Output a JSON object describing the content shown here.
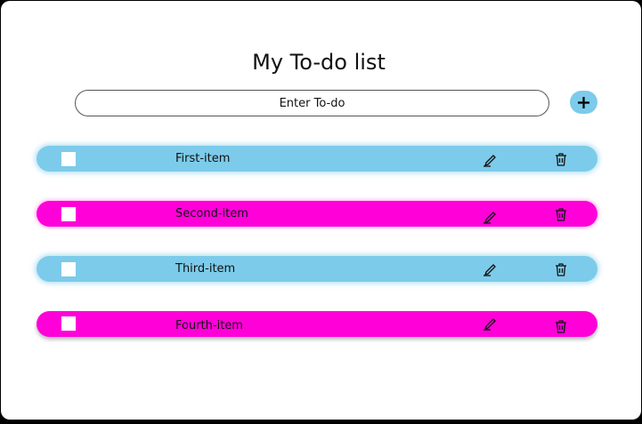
{
  "header": {
    "title": "My To-do list"
  },
  "input": {
    "placeholder": "Enter To-do",
    "value": ""
  },
  "add_button": {
    "icon": "plus-icon"
  },
  "colors": {
    "blue": "#7ccbea",
    "pink": "#ff00d9"
  },
  "todos": [
    {
      "label": "First-item",
      "color": "blue",
      "checked": false
    },
    {
      "label": "Second-item",
      "color": "pink",
      "checked": false
    },
    {
      "label": "Third-item",
      "color": "blue",
      "checked": false
    },
    {
      "label": "Fourth-item",
      "color": "pink",
      "checked": false
    }
  ],
  "row_icons": {
    "edit": "pencil-icon",
    "delete": "trash-icon"
  }
}
